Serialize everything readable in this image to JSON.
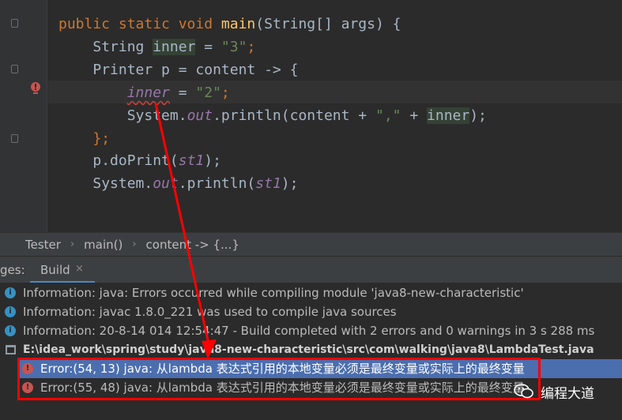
{
  "editor": {
    "lines": [
      {
        "indent": "",
        "parts": [
          {
            "t": "public static void ",
            "c": "kw"
          },
          {
            "t": "main",
            "c": "fn"
          },
          {
            "t": "(String[] args) {",
            "c": ""
          }
        ]
      },
      {
        "indent": "    ",
        "parts": [
          {
            "t": "String ",
            "c": ""
          },
          {
            "t": "inner",
            "c": "hl"
          },
          {
            "t": " = ",
            "c": ""
          },
          {
            "t": "\"3\"",
            "c": "str"
          },
          {
            "t": ";",
            "c": "kw"
          }
        ]
      },
      {
        "indent": "    ",
        "parts": [
          {
            "t": "Printer p = content -> {",
            "c": ""
          }
        ]
      },
      {
        "indent": "        ",
        "parts": [
          {
            "t": "inner",
            "c": "it wavy"
          },
          {
            "t": " = ",
            "c": ""
          },
          {
            "t": "\"2\"",
            "c": "str"
          },
          {
            "t": ";",
            "c": "kw"
          }
        ]
      },
      {
        "indent": "        ",
        "parts": [
          {
            "t": "System.",
            "c": ""
          },
          {
            "t": "out",
            "c": "it"
          },
          {
            "t": ".println(content + ",
            "c": ""
          },
          {
            "t": "\",\"",
            "c": "str"
          },
          {
            "t": " + ",
            "c": ""
          },
          {
            "t": "inner",
            "c": "hl"
          },
          {
            "t": ");",
            "c": ""
          }
        ]
      },
      {
        "indent": "    ",
        "parts": [
          {
            "t": "};",
            "c": "kw"
          }
        ]
      },
      {
        "indent": "    ",
        "parts": [
          {
            "t": "p.doPrint(",
            "c": ""
          },
          {
            "t": "st1",
            "c": "it"
          },
          {
            "t": ");",
            "c": ""
          }
        ]
      },
      {
        "indent": "    ",
        "parts": [
          {
            "t": "System.",
            "c": ""
          },
          {
            "t": "out",
            "c": "it"
          },
          {
            "t": ".println(",
            "c": ""
          },
          {
            "t": "st1",
            "c": "it"
          },
          {
            "t": ");",
            "c": ""
          }
        ]
      }
    ]
  },
  "breadcrumb": {
    "items": [
      "Tester",
      "main()",
      "content -> {...}"
    ],
    "separator": "›"
  },
  "toolbar": {
    "prev_tab_label": "ges:",
    "build_tab_label": "Build",
    "close_glyph": "×"
  },
  "build_output": {
    "info_icon_glyph": "i",
    "error_icon_glyph": "!",
    "info_lines": [
      "Information: java: Errors occurred while compiling module 'java8-new-characteristic'",
      "Information: javac 1.8.0_221 was used to compile java sources",
      "Information: 20-8-14 014 12:54:47 - Build completed with 2 errors and 0 warnings in 3 s 288 ms"
    ],
    "file_path": "E:\\idea_work\\spring\\study\\java8-new-characteristic\\src\\com\\walking\\java8\\LambdaTest.java",
    "errors": [
      "Error:(54, 13)  java: 从lambda 表达式引用的本地变量必须是最终变量或实际上的最终变量",
      "Error:(55, 48)  java: 从lambda 表达式引用的本地变量必须是最终变量或实际上的最终变量"
    ]
  },
  "watermark": {
    "text": "编程大道"
  },
  "colors": {
    "annotation_red": "#ff0000",
    "selection_blue": "#4b6eaf",
    "error_red": "#c75450",
    "info_blue": "#3592c4"
  }
}
